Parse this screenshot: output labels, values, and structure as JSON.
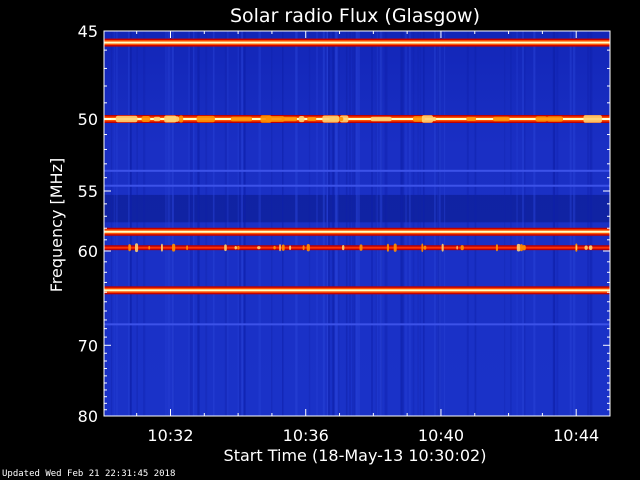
{
  "chart_data": {
    "type": "heatmap",
    "title": "Solar radio Flux (Glasgow)",
    "xlabel": "Start Time (18-May-13 10:30:02)",
    "ylabel": "Frequency [MHz]",
    "x_start": "10:30:02",
    "x_end": "10:45:00",
    "x_ticks": [
      "10:32",
      "10:36",
      "10:40",
      "10:44"
    ],
    "x_tick_values": [
      "10:32",
      "10:36",
      "10:40",
      "10:44"
    ],
    "ylim": [
      45,
      80
    ],
    "y_scale": "reciprocal",
    "y_ticks": [
      45,
      50,
      55,
      60,
      70,
      80
    ],
    "y_tick_labels": [
      "45",
      "50",
      "55",
      "60",
      "70",
      "80"
    ],
    "colormap": [
      "#000080",
      "#1028d0",
      "#b00000",
      "#ff2000",
      "#ff9000",
      "#ffff80",
      "#ffffff"
    ],
    "background_color": "#1a2fc4",
    "features": [
      {
        "name": "strong band",
        "freq_mhz": 45.6,
        "intensity": "high"
      },
      {
        "name": "bursty band",
        "freq_mhz": 50.0,
        "intensity": "high"
      },
      {
        "name": "weak band",
        "freq_mhz": 53.5,
        "intensity": "low"
      },
      {
        "name": "weak band",
        "freq_mhz": 54.6,
        "intensity": "low"
      },
      {
        "name": "strong band",
        "freq_mhz": 58.3,
        "intensity": "high"
      },
      {
        "name": "bursty band",
        "freq_mhz": 59.7,
        "intensity": "medium"
      },
      {
        "name": "strong band",
        "freq_mhz": 63.8,
        "intensity": "high"
      },
      {
        "name": "weak band",
        "freq_mhz": 67.5,
        "intensity": "low"
      }
    ]
  },
  "footer": {
    "updated": "Updated Wed Feb 21 22:31:45 2018"
  }
}
